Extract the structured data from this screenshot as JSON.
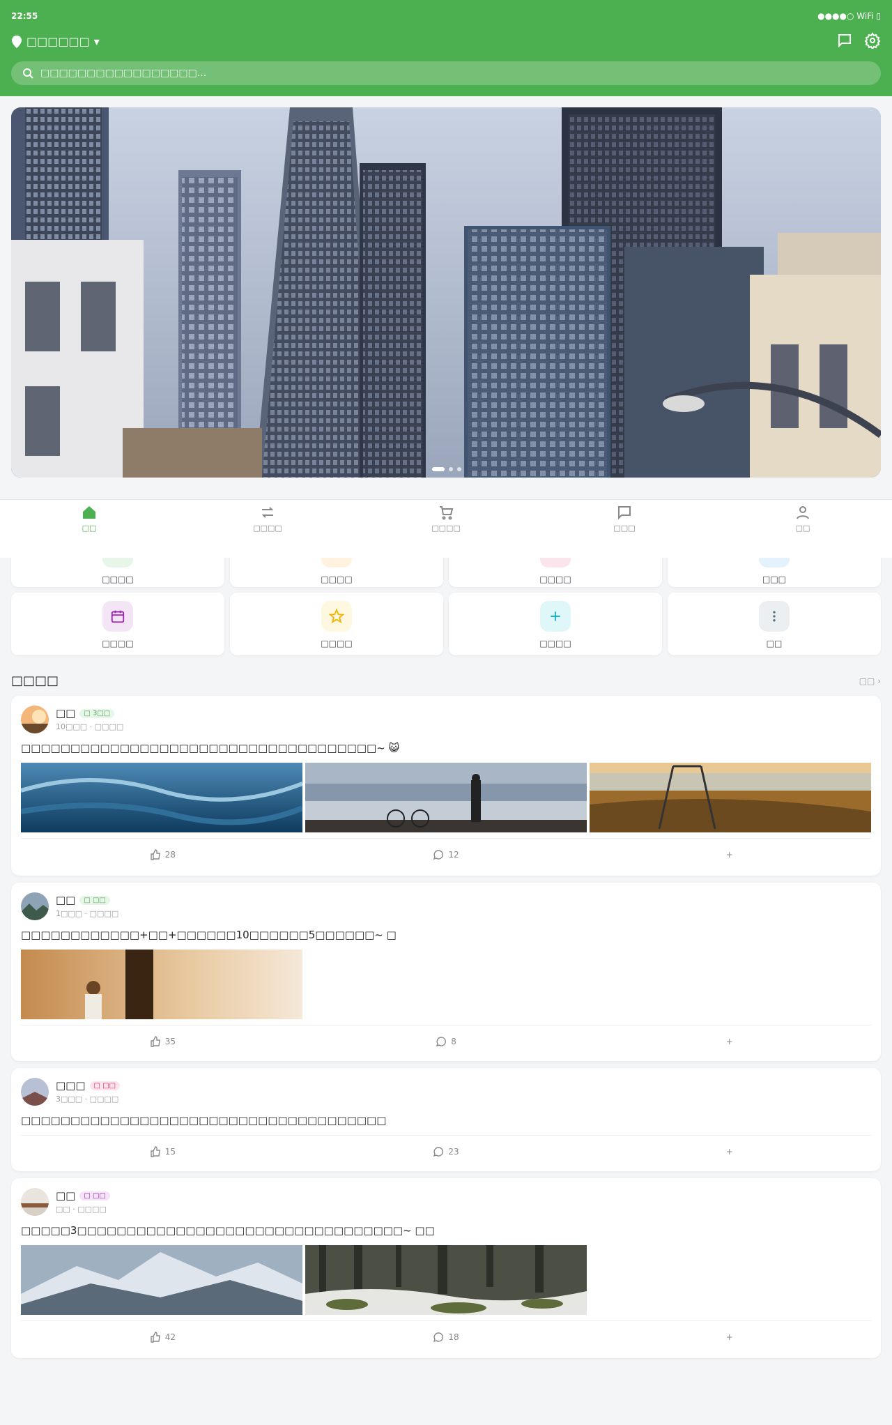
{
  "status_bar": {
    "time": "22:55",
    "right": "●●●●○ WiFi ▯"
  },
  "header": {
    "location": "□□□□□□",
    "location_caret": "▾",
    "search_placeholder": "□□□□□□□□□□□□□□□□□..."
  },
  "banner": {
    "page_index": 1,
    "page_count": 3
  },
  "tabbar": [
    {
      "label": "□□",
      "icon": "home-icon",
      "active": true
    },
    {
      "label": "□□□□",
      "icon": "swap-icon"
    },
    {
      "label": "□□□□",
      "icon": "cart-icon"
    },
    {
      "label": "□□□",
      "icon": "message-icon"
    },
    {
      "label": "□□",
      "icon": "user-icon"
    }
  ],
  "categories_row1": [
    {
      "label": "□□□□",
      "color": "#e8f5e9"
    },
    {
      "label": "□□□□",
      "color": "#fff3e0"
    },
    {
      "label": "□□□□",
      "color": "#fce4ec"
    },
    {
      "label": "□□□",
      "color": "#e3f2fd"
    }
  ],
  "categories_row2": [
    {
      "label": "□□□□",
      "icon": "calendar-icon",
      "color": "#f3e5f5",
      "stroke": "#9c27b0"
    },
    {
      "label": "□□□□",
      "icon": "star-icon",
      "color": "#fff8e1",
      "stroke": "#f4b400"
    },
    {
      "label": "□□□□",
      "icon": "plus-icon",
      "color": "#e0f7fa",
      "stroke": "#00acc1"
    },
    {
      "label": "□□",
      "icon": "more-icon",
      "color": "#eceff1",
      "stroke": "#546e7a"
    }
  ],
  "feed": {
    "title": "□□□□",
    "more": "□□ ›",
    "posts": [
      {
        "name": "□□",
        "badge": "□ 3□□",
        "badge_color": "#4caf50",
        "badge_bg": "#e8f5e9",
        "meta": "10□□□ · □□□□",
        "text": "□□□□□□□□□□□□□□□□□□□□□□□□□□□□□□□□□□□□~ 😺",
        "likes": "28",
        "comments": "12",
        "share": "+"
      },
      {
        "name": "□□",
        "badge": "□ □□",
        "badge_color": "#4caf50",
        "badge_bg": "#e8f5e9",
        "meta": "1□□□ · □□□□",
        "text": "□□□□□□□□□□□□+□□+□□□□□□10□□□□□□5□□□□□□~ □",
        "likes": "35",
        "comments": "8",
        "share": "+"
      },
      {
        "name": "□□□",
        "badge": "□ □□",
        "badge_color": "#e91e63",
        "badge_bg": "#fce4ec",
        "meta": "3□□□ · □□□□",
        "text": "□□□□□□□□□□□□□□□□□□□□□□□□□□□□□□□□□□□□□",
        "likes": "15",
        "comments": "23",
        "share": "+"
      },
      {
        "name": "□□",
        "badge": "□ □□",
        "badge_color": "#9c27b0",
        "badge_bg": "#f3e5f5",
        "meta": "□□ · □□□□",
        "text": "□□□□□3□□□□□□□□□□□□□□□□□□□□□□□□□□□□□□□□□~ □□",
        "likes": "42",
        "comments": "18",
        "share": "+"
      }
    ]
  }
}
